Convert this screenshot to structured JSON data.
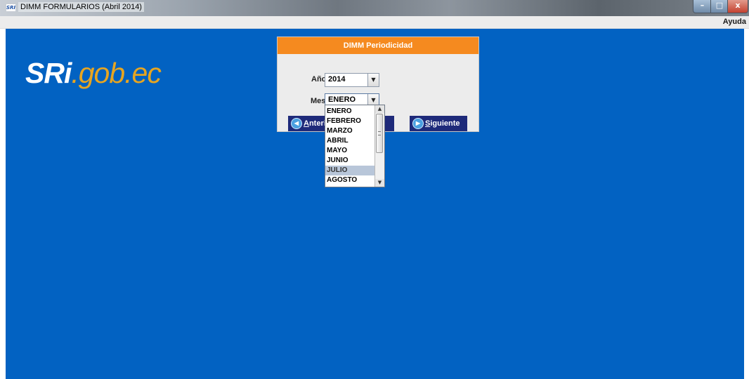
{
  "window": {
    "icon_label": "SRI",
    "title": "DIMM FORMULARIOS (Abril 2014)",
    "minimize_glyph": "–",
    "maximize_glyph": "□",
    "close_glyph": "x"
  },
  "menu": {
    "ayuda": "Ayuda"
  },
  "logo": {
    "part1": "SRi",
    "part2": ".gob.ec"
  },
  "dialog": {
    "header": "DIMM Periodicidad",
    "anio_label": "Año:",
    "anio_value": "2014",
    "mes_label": "Mes:",
    "mes_value": "ENERO",
    "prev_button_prefix": "A",
    "prev_button_rest": "nterio",
    "middle_fragment": "o",
    "next_button_prefix": "S",
    "next_button_rest": "iguiente"
  },
  "months_dropdown": {
    "items": [
      "ENERO",
      "FEBRERO",
      "MARZO",
      "ABRIL",
      "MAYO",
      "JUNIO",
      "JULIO",
      "AGOSTO"
    ],
    "highlighted": "JULIO"
  },
  "icons": {
    "prev": "circle-left-arrow-icon",
    "next": "circle-right-arrow-icon",
    "combo_arrow": "chevron-down-icon"
  },
  "colors": {
    "background": "#0262c2",
    "header_orange": "#f58a1f",
    "nav_button": "#1e2a7a",
    "logo_accent": "#e6a521"
  }
}
